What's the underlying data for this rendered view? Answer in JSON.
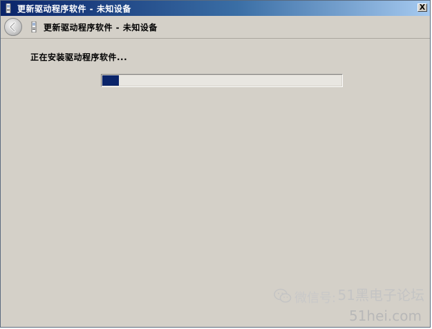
{
  "window": {
    "title": "更新驱动程序软件 - 未知设备",
    "close_label": "X"
  },
  "header": {
    "title": "更新驱动程序软件 - 未知设备"
  },
  "main": {
    "status_text": "正在安装驱动程序软件...",
    "progress_fraction": 0.07
  },
  "watermark": {
    "line1": "51黑电子论坛",
    "line2": "微信号:",
    "line3": "51hei.com"
  },
  "colors": {
    "title_gradient_start": "#0a246a",
    "progress_fill": "#0a246a",
    "window_background": "#d4d0c8"
  },
  "icons": {
    "app": "device-icon",
    "back": "back-arrow-icon",
    "close": "close-icon",
    "watermark": "wechat-icon"
  }
}
